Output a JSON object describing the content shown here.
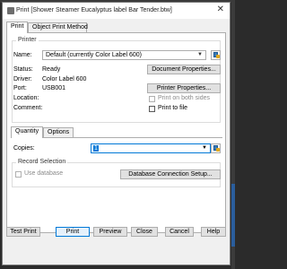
{
  "window": {
    "title": "Print [Shower Steamer Eucalyptus label Bar Tender.btw]",
    "close_glyph": "✕"
  },
  "tabs": [
    {
      "label": "Print",
      "active": true
    },
    {
      "label": "Object Print Method",
      "active": false
    }
  ],
  "printer": {
    "group_label": "Printer",
    "name_label": "Name:",
    "name_value": "Default (currently Color Label 600)",
    "status_label": "Status:",
    "status_value": "Ready",
    "driver_label": "Driver:",
    "driver_value": "Color Label 600",
    "port_label": "Port:",
    "port_value": "USB001",
    "location_label": "Location:",
    "comment_label": "Comment:",
    "document_properties_label": "Document Properties...",
    "printer_properties_label": "Printer Properties...",
    "print_both_sides_label": "Print on both sides",
    "print_to_file_label": "Print to file"
  },
  "inner_tabs": [
    {
      "label": "Quantity",
      "active": true
    },
    {
      "label": "Options",
      "active": false
    }
  ],
  "quantity": {
    "copies_label": "Copies:",
    "copies_value": "1"
  },
  "record_selection": {
    "group_label": "Record Selection",
    "use_database_label": "Use database",
    "db_setup_label": "Database Connection Setup..."
  },
  "footer_buttons": {
    "test_print": "Test Print",
    "print": "Print",
    "preview": "Preview",
    "close": "Close",
    "cancel": "Cancel",
    "help": "Help"
  },
  "colors": {
    "accent": "#0078d7",
    "dialog_bg": "#f0f0f0"
  }
}
